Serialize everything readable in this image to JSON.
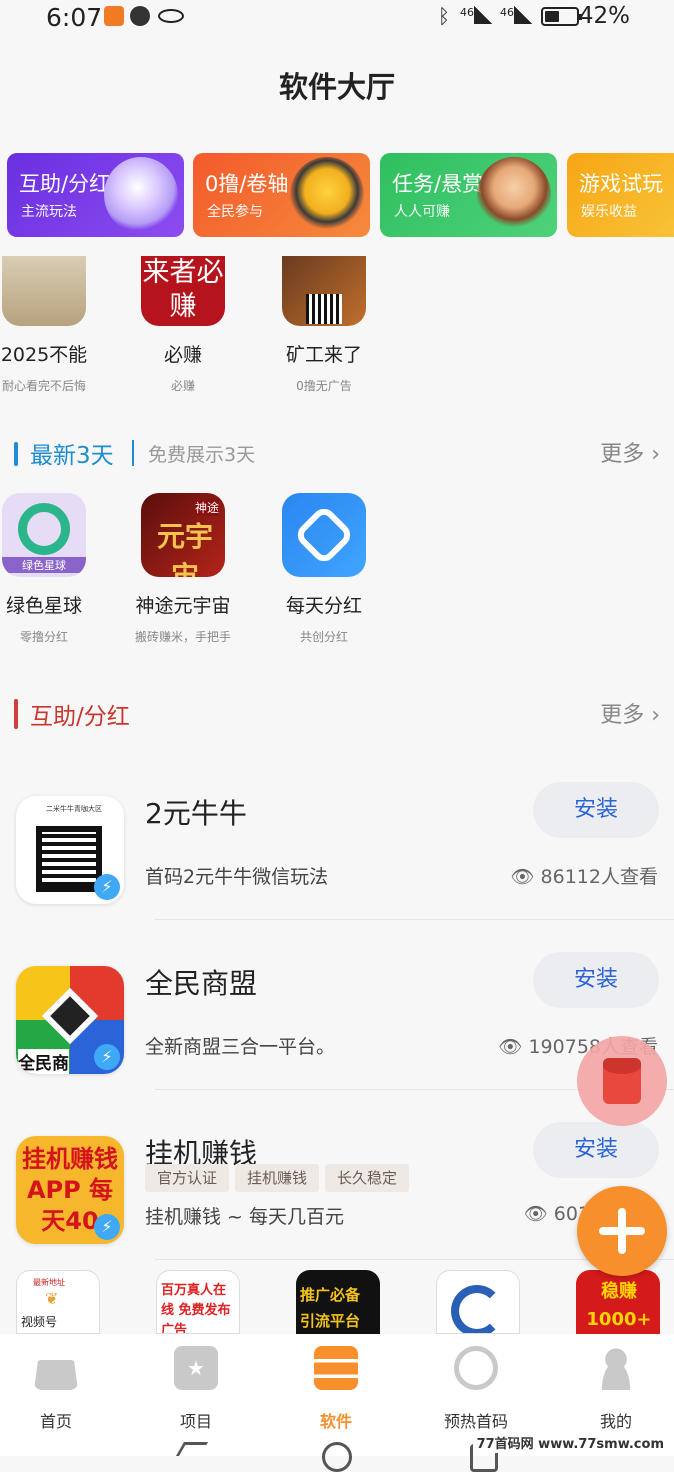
{
  "status": {
    "time": "6:07",
    "signal1": "46⁺",
    "signal2": "46",
    "battery": "42%"
  },
  "header": {
    "title": "软件大厅"
  },
  "categories": [
    {
      "title": "互助/分红",
      "sub": "主流玩法",
      "color": "#7b3fdf"
    },
    {
      "title": "0撸/卷轴",
      "sub": "全民参与",
      "color": "#f0652e"
    },
    {
      "title": "任务/悬赏",
      "sub": "人人可赚",
      "color": "#3cc06a"
    },
    {
      "title": "游戏试玩",
      "sub": "娱乐收益",
      "color": "#f7b520"
    }
  ],
  "top_apps": [
    {
      "name": "2025不能",
      "desc": "耐心看完不后悔"
    },
    {
      "name": "必赚",
      "desc": "必赚",
      "icon_text": "来者必赚"
    },
    {
      "name": "矿工来了",
      "desc": "0撸无广告"
    }
  ],
  "newest": {
    "title": "最新3天",
    "subtitle": "免费展示3天",
    "more": "更多 ›"
  },
  "new_apps": [
    {
      "name": "绿色星球",
      "desc": "零撸分红",
      "icon_text": "绿色星球"
    },
    {
      "name": "神途元宇宙",
      "desc": "搬砖赚米，手把手",
      "icon_text": "元宇宙",
      "icon_small": "神途"
    },
    {
      "name": "每天分红",
      "desc": "共创分红"
    }
  ],
  "mutual": {
    "title": "互助/分红",
    "more": "更多 ›"
  },
  "list": [
    {
      "name": "2元牛牛",
      "desc": "首码2元牛牛微信玩法",
      "views": "86112人查看",
      "button": "安装",
      "icon_caption": "二米牛牛青咖大区"
    },
    {
      "name": "全民商盟",
      "desc": "全新商盟三合一平台。",
      "views": "190758人查看",
      "button": "安装",
      "icon_caption": "全民商"
    },
    {
      "name": "挂机赚钱",
      "desc": "挂机赚钱 ~ 每天几百元",
      "views": "601",
      "button": "安装",
      "tags": [
        "官方认证",
        "挂机赚钱",
        "长久稳定"
      ],
      "icon_text": "挂机赚钱 APP 每天40"
    }
  ],
  "strip": [
    {
      "text": "视频号",
      "top": "最新地址"
    },
    {
      "text": "百万真人在线 免费发布广告"
    },
    {
      "text": "推广必备 引流平台"
    },
    {
      "text": ""
    },
    {
      "text": "稳赚 1000+"
    }
  ],
  "tabs": [
    {
      "label": "首页",
      "active": false
    },
    {
      "label": "项目",
      "active": false
    },
    {
      "label": "软件",
      "active": true
    },
    {
      "label": "预热首码",
      "active": false
    },
    {
      "label": "我的",
      "active": false
    }
  ],
  "watermark": "77首码网 www.77smw.com"
}
